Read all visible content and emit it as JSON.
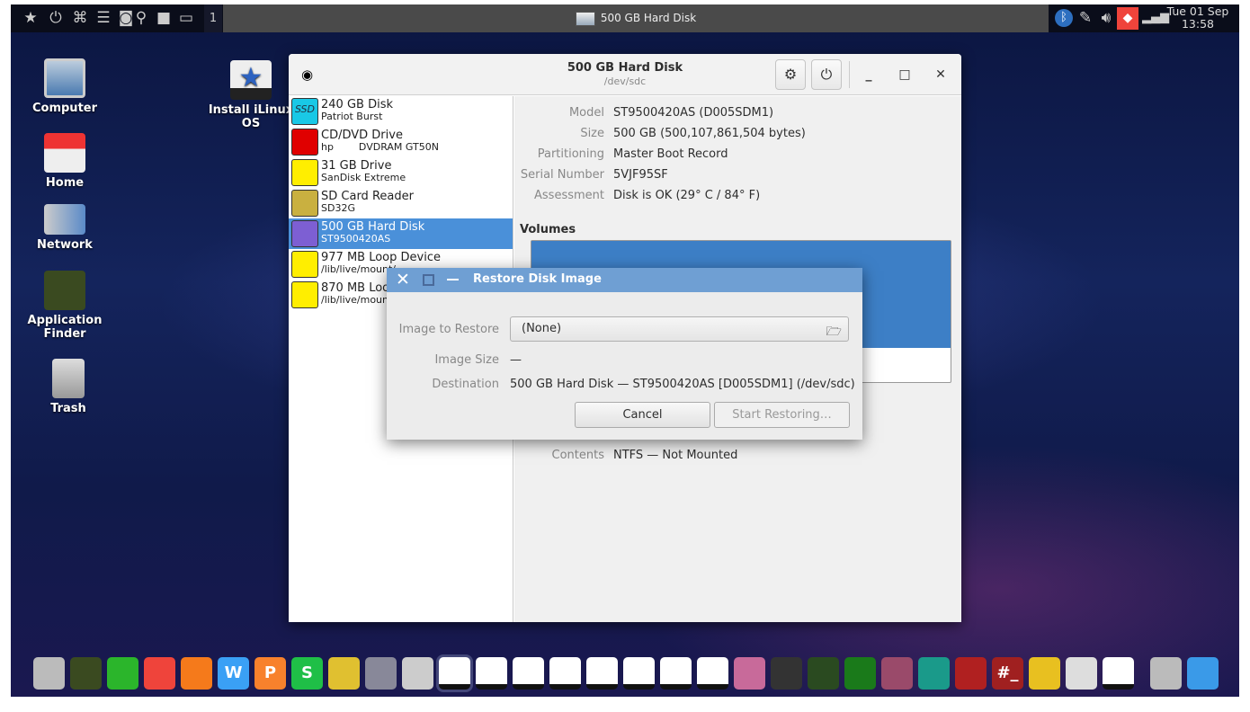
{
  "topbar": {
    "workspace": "1",
    "task_title": "500 GB Hard Disk",
    "date": "Tue 01 Sep",
    "time": "13:58",
    "launchers": [
      "star-icon",
      "power-icon",
      "binoculars-icon",
      "storage-icon",
      "disk-utility-icon",
      "search-icon",
      "folder-icon",
      "desktop-icon"
    ],
    "tray": [
      "bluetooth-icon",
      "pin-icon",
      "volume-icon",
      "anydesk-icon",
      "signal-icon"
    ]
  },
  "desktop_icons": [
    {
      "label": "Computer"
    },
    {
      "label": "Home"
    },
    {
      "label": "Network"
    },
    {
      "label": "Application Finder"
    },
    {
      "label": "Trash"
    },
    {
      "label": "Install iLinux OS"
    }
  ],
  "window": {
    "title": "500 GB Hard Disk",
    "subtitle": "/dev/sdc",
    "drives": [
      {
        "name": "240 GB Disk",
        "sub": "Patriot Burst",
        "icon": "ssd-icon",
        "color": "#19c8e6",
        "tag": "SSD"
      },
      {
        "name": "CD/DVD Drive",
        "sub": "hp        DVDRAM GT50N",
        "icon": "optical-drive-icon",
        "color": "#e00000"
      },
      {
        "name": "31 GB Drive",
        "sub": "SanDisk Extreme",
        "icon": "usb-drive-icon",
        "color": "#ffee00"
      },
      {
        "name": "SD Card Reader",
        "sub": "SD32G",
        "icon": "sd-card-icon",
        "color": "#c9b040"
      },
      {
        "name": "500 GB Hard Disk",
        "sub": "ST9500420AS",
        "icon": "usb-disk-icon",
        "color": "#7d5fd3",
        "selected": true
      },
      {
        "name": "977 MB Loop Device",
        "sub": "/lib/live/mount/...",
        "icon": "loop-device-icon",
        "color": "#ffee00"
      },
      {
        "name": "870 MB Loop Device",
        "sub": "/lib/live/mount/...",
        "icon": "loop-device-icon",
        "color": "#ffee00"
      }
    ],
    "details": [
      {
        "k": "Model",
        "v": "ST9500420AS (D005SDM1)"
      },
      {
        "k": "Size",
        "v": "500 GB (500,107,861,504 bytes)"
      },
      {
        "k": "Partitioning",
        "v": "Master Boot Record"
      },
      {
        "k": "Serial Number",
        "v": "5VJF95SF"
      },
      {
        "k": "Assessment",
        "v": "Disk is OK (29° C / 84° F)"
      }
    ],
    "volumes_label": "Volumes",
    "contents": {
      "k": "Contents",
      "v": "NTFS — Not Mounted"
    }
  },
  "dialog": {
    "title": "Restore Disk Image",
    "image_label": "Image to Restore",
    "image_value": "(None)",
    "size_label": "Image Size",
    "size_value": "—",
    "dest_label": "Destination",
    "dest_value": "500 GB Hard Disk — ST9500420AS [D005SDM1] (/dev/sdc)",
    "cancel": "Cancel",
    "start": "Start Restoring…"
  },
  "dock": [
    {
      "name": "file-cabinet-icon",
      "color": "#bbb"
    },
    {
      "name": "binoculars-icon",
      "color": "#3a4a20"
    },
    {
      "name": "green-pipe-icon",
      "color": "#2bb52b"
    },
    {
      "name": "anydesk-icon",
      "color": "#ef443b"
    },
    {
      "name": "firefox-icon",
      "color": "#f57a1b"
    },
    {
      "name": "wps-writer-icon",
      "color": "#3aa0f5",
      "t": "W"
    },
    {
      "name": "wps-presentation-icon",
      "color": "#f8812c",
      "t": "P"
    },
    {
      "name": "wps-spreadsheet-icon",
      "color": "#1fbf47",
      "t": "S"
    },
    {
      "name": "genie-lamp-icon",
      "color": "#e0c030"
    },
    {
      "name": "screenshot-icon",
      "color": "#889"
    },
    {
      "name": "disc-edit-icon",
      "color": "#ccc"
    },
    {
      "name": "tools-disk-icon",
      "color": "#fff",
      "active": true
    },
    {
      "name": "pie-chart-disk-icon",
      "color": "#fff"
    },
    {
      "name": "health-disk-icon",
      "color": "#fff"
    },
    {
      "name": "gauge-disk-icon",
      "color": "#fff"
    },
    {
      "name": "analyzer-disk-icon",
      "color": "#fff"
    },
    {
      "name": "restore-disk-icon",
      "color": "#fff"
    },
    {
      "name": "install-disk-icon",
      "color": "#fff"
    },
    {
      "name": "ilinux-disk-icon",
      "color": "#fff"
    },
    {
      "name": "sync-icon",
      "color": "#c86a9a"
    },
    {
      "name": "scanner-icon",
      "color": "#333"
    },
    {
      "name": "system-monitor-icon",
      "color": "#2a4a20"
    },
    {
      "name": "radar-icon",
      "color": "#1a7a1a"
    },
    {
      "name": "wallpaper-icon",
      "color": "#9a4a6a"
    },
    {
      "name": "runner-icon",
      "color": "#1a9a8a"
    },
    {
      "name": "multi-terminal-icon",
      "color": "#b02020"
    },
    {
      "name": "root-terminal-icon",
      "color": "#a02020",
      "t": "#_"
    },
    {
      "name": "lock-settings-icon",
      "color": "#e8c020"
    },
    {
      "name": "usb-to-disc-icon",
      "color": "#ddd"
    },
    {
      "name": "power-icon",
      "color": "#fff"
    },
    {
      "name": "trash-icon",
      "color": "#bbb"
    },
    {
      "name": "show-desktop-icon",
      "color": "#3a9ae8"
    }
  ]
}
